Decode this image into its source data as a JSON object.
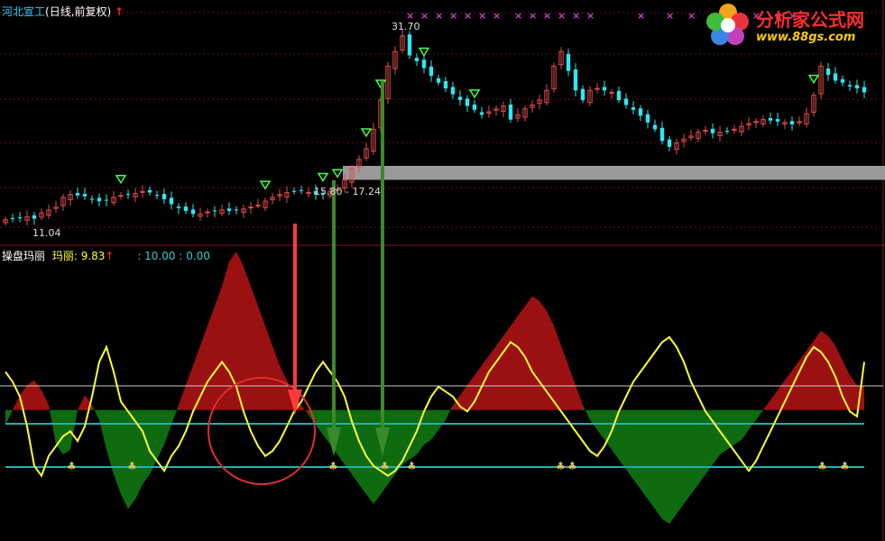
{
  "top_panel": {
    "stock_name": "河北宣工",
    "period_label": "(日线,前复权)",
    "high_label": "31.70",
    "low_label": "11.04",
    "range_label": "15.80 - 17.24"
  },
  "bottom_panel": {
    "indicator_name": "操盘玛丽",
    "value_label": "玛丽: 9.83",
    "levels_label": ": 10.00 : 0.00"
  },
  "logo": {
    "title": "分析家公式网",
    "url": "www.88gs.com"
  },
  "colors": {
    "background": "#000000",
    "up": "#e24a4a",
    "down": "#2ee8f0",
    "title": "#33ccff",
    "positive_area": "#9b1010",
    "negative_area": "#0e6b10",
    "line": "#ffff33",
    "level_line": "#20b0b0",
    "marker": "#cc44cc",
    "arrow_red": "#ff3a3a",
    "arrow_green": "#3a8a2a"
  },
  "chart_data": [
    {
      "type": "candlestick",
      "price_range": [
        10,
        33
      ],
      "low_label": 11.04,
      "high_label": 31.7,
      "shaded_band": [
        15.8,
        17.24
      ],
      "bars": 120,
      "close": [
        11.7,
        11.8,
        11.9,
        12.0,
        11.8,
        12.4,
        12.7,
        13.0,
        14.0,
        14.3,
        14.2,
        14.1,
        13.8,
        13.6,
        13.7,
        14.0,
        14.2,
        14.3,
        14.4,
        14.6,
        14.5,
        14.2,
        13.8,
        13.3,
        12.9,
        12.6,
        12.3,
        12.3,
        12.5,
        12.6,
        12.7,
        12.6,
        12.7,
        12.8,
        13.0,
        13.2,
        13.6,
        14.0,
        14.3,
        14.5,
        14.6,
        14.7,
        14.5,
        14.3,
        14.4,
        14.6,
        14.8,
        15.8,
        17.0,
        17.9,
        19.0,
        21.0,
        24.0,
        27.5,
        29.0,
        30.6,
        28.6,
        28.0,
        27.3,
        26.5,
        25.8,
        25.2,
        24.6,
        24.0,
        23.4,
        23.0,
        22.5,
        22.8,
        23.1,
        23.4,
        22.0,
        22.5,
        23.1,
        23.5,
        24.0,
        25.0,
        27.5,
        29.0,
        27.0,
        25.0,
        24.0,
        25.0,
        25.2,
        25.0,
        24.8,
        24.0,
        23.5,
        23.0,
        22.4,
        21.7,
        21.0,
        19.8,
        19.2,
        19.6,
        20.0,
        20.3,
        20.7,
        20.9,
        20.6,
        20.7,
        20.8,
        21.0,
        21.3,
        21.6,
        21.8,
        22.0,
        21.9,
        21.8,
        21.7,
        21.5,
        21.8,
        22.6,
        24.5,
        27.5,
        26.6,
        26.0,
        25.8,
        25.4,
        25.2,
        24.8
      ],
      "down_arrow_bars": [
        16,
        36,
        44,
        46,
        50,
        52,
        58,
        65,
        112
      ],
      "cross_marker_bars": [
        56,
        58,
        60,
        62,
        64,
        66,
        68,
        71,
        73,
        75,
        77,
        79,
        81,
        88,
        92,
        95,
        98,
        101,
        104,
        107,
        109
      ]
    },
    {
      "type": "area",
      "indicator": "操盘玛丽",
      "current_value": 9.83,
      "levels": [
        10.0,
        0.0
      ],
      "range": [
        -20,
        35
      ],
      "mali": [
        2,
        5,
        8,
        10,
        11,
        9,
        6,
        -2,
        -4,
        -3,
        5,
        8,
        6,
        3,
        -3,
        -8,
        -12,
        -15,
        -13,
        -10,
        -8,
        -5,
        -2,
        2,
        6,
        10,
        14,
        18,
        22,
        26,
        30,
        35,
        37,
        34,
        30,
        26,
        22,
        18,
        14,
        11,
        8,
        6,
        4,
        2,
        0,
        -2,
        -4,
        -6,
        -8,
        -10,
        -12,
        -14,
        -12,
        -10,
        -8,
        -6,
        -5,
        -4,
        -2,
        -1,
        1,
        3,
        6,
        8,
        10,
        12,
        14,
        16,
        18,
        20,
        22,
        24,
        26,
        28,
        27,
        25,
        22,
        18,
        14,
        10,
        6,
        3,
        1,
        -1,
        -3,
        -5,
        -7,
        -9,
        -11,
        -13,
        -15,
        -17,
        -18,
        -16,
        -14,
        -12,
        -10,
        -8,
        -6,
        -4,
        -3,
        -2,
        -1,
        1,
        3,
        5,
        7,
        9,
        11,
        13,
        15,
        17,
        19,
        21,
        20,
        18,
        15,
        12,
        10,
        9.83
      ],
      "signal": [
        20,
        18,
        15,
        9,
        1,
        -1,
        3,
        5,
        7,
        8,
        6,
        9,
        15,
        22,
        25,
        20,
        14,
        12,
        10,
        8,
        4,
        2,
        0,
        3,
        5,
        8,
        12,
        15,
        18,
        20,
        22,
        20,
        17,
        12,
        8,
        5,
        3,
        4,
        6,
        9,
        12,
        14,
        17,
        20,
        22,
        20,
        18,
        15,
        10,
        6,
        3,
        1,
        0,
        -1,
        0,
        2,
        5,
        8,
        12,
        15,
        17,
        16,
        15,
        13,
        12,
        14,
        17,
        20,
        22,
        24,
        26,
        25,
        23,
        20,
        18,
        16,
        14,
        12,
        10,
        8,
        6,
        4,
        3,
        5,
        8,
        12,
        15,
        18,
        20,
        22,
        24,
        26,
        27,
        25,
        22,
        18,
        15,
        12,
        10,
        8,
        6,
        4,
        2,
        0,
        2,
        5,
        8,
        11,
        14,
        17,
        20,
        23,
        25,
        24,
        22,
        19,
        15,
        12,
        11,
        22
      ]
    }
  ]
}
